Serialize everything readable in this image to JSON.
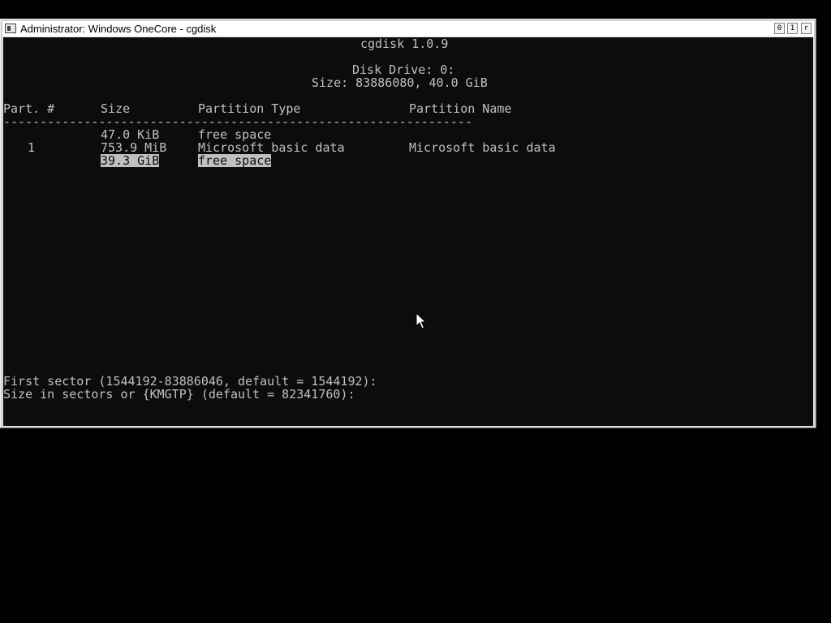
{
  "window": {
    "title": "Administrator:  Windows OneCore - cgdisk",
    "controls": [
      "0",
      "1",
      "r"
    ]
  },
  "header": {
    "program": "cgdisk 1.0.9",
    "disk_drive": "Disk Drive: 0:",
    "size": "Size: 83886080, 40.0 GiB"
  },
  "table": {
    "columns": [
      "Part. #",
      "Size",
      "Partition Type",
      "Partition Name"
    ],
    "separator": "----------------------------------------------------------------",
    "rows": [
      {
        "num": "",
        "size": "47.0 KiB",
        "type": "free space",
        "name": ""
      },
      {
        "num": "1",
        "size": "753.9 MiB",
        "type": "Microsoft basic data",
        "name": "Microsoft basic data"
      },
      {
        "num": "",
        "size": "39.3 GiB",
        "type": "free space",
        "name": "",
        "selected": true
      }
    ]
  },
  "prompts": {
    "first_sector": "First sector (1544192-83886046, default = 1544192):",
    "size_sectors": "Size in sectors or {KMGTP} (default = 82341760):"
  },
  "colors": {
    "console_bg": "#0c0c0c",
    "console_fg": "#c0c0c0",
    "desktop": "#000000"
  }
}
